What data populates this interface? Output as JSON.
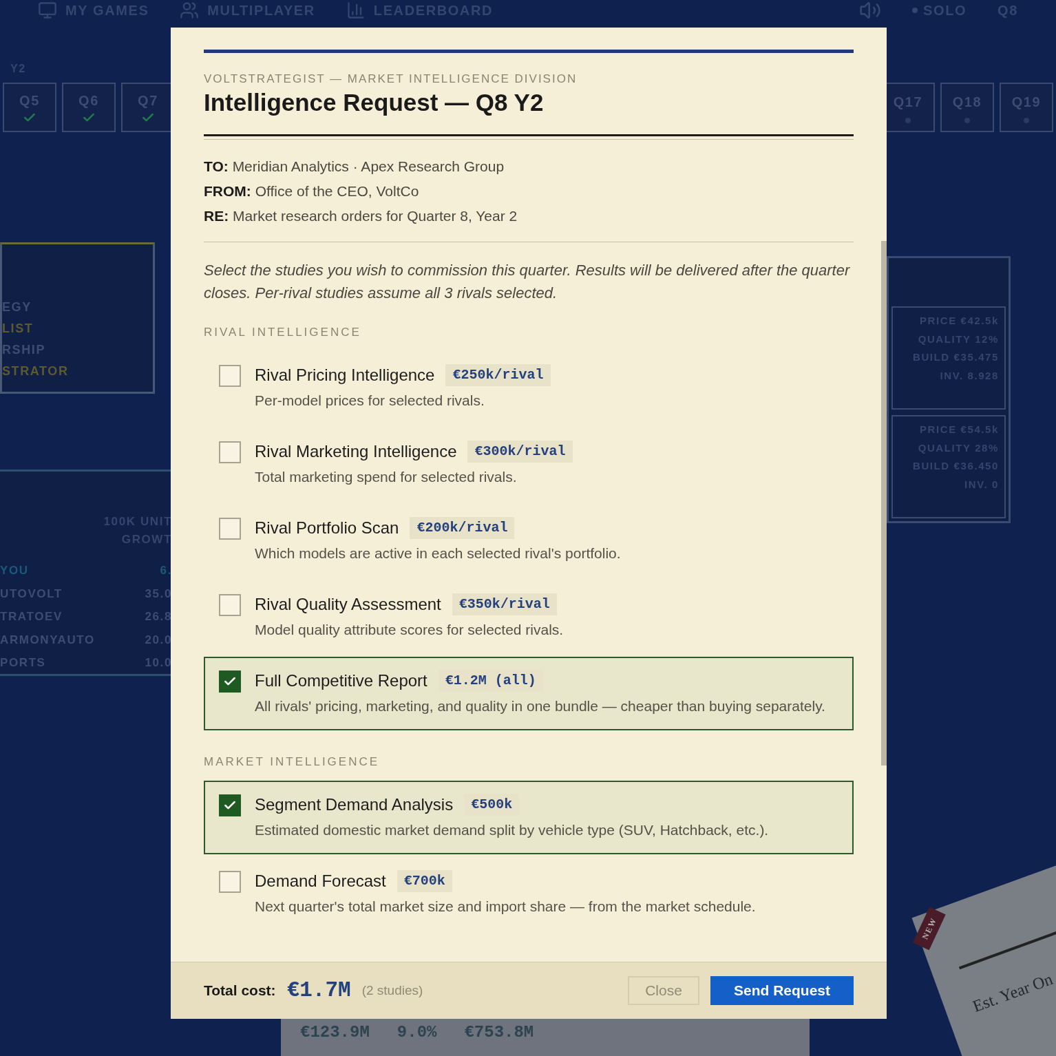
{
  "background": {
    "nav": [
      {
        "label": "MY GAMES",
        "kind": "monitor"
      },
      {
        "label": "MULTIPLAYER",
        "kind": "users"
      },
      {
        "label": "LEADERBOARD",
        "kind": "chart"
      }
    ],
    "mode": "SOLO",
    "quarter": "Q8",
    "season": "Y2",
    "quarters_left": [
      {
        "label": "Q5",
        "done": true
      },
      {
        "label": "Q6",
        "done": true
      },
      {
        "label": "Q7",
        "done": true
      }
    ],
    "quarters_right": [
      {
        "label": "Q17",
        "done": false
      },
      {
        "label": "Q18",
        "done": false
      },
      {
        "label": "Q19",
        "done": false
      }
    ],
    "profile_lines": [
      {
        "label": "EGY",
        "highlight": false
      },
      {
        "label": "LIST",
        "highlight": true
      },
      {
        "label": "RSHIP",
        "highlight": false
      },
      {
        "label": "STRATOR",
        "highlight": true
      }
    ],
    "table_header": [
      "100K UNIT",
      "GROWT"
    ],
    "table_rows": [
      {
        "name": "YOU",
        "value": "6.",
        "you": true
      },
      {
        "name": "UTOVOLT",
        "value": "35.0",
        "you": false
      },
      {
        "name": "TRATOEV",
        "value": "26.8",
        "you": false
      },
      {
        "name": "ARMONYAUTO",
        "value": "20.0",
        "you": false
      },
      {
        "name": "PORTS",
        "value": "10.0",
        "you": false
      }
    ],
    "model_cards": [
      {
        "fields": [
          {
            "label": "PRICE",
            "value": "€42.5k"
          },
          {
            "label": "QUALITY",
            "value": "12%"
          },
          {
            "label": "BUILD",
            "value": "€35.475"
          },
          {
            "label": "INV.",
            "value": "8.928"
          }
        ]
      },
      {
        "fields": [
          {
            "label": "PRICE",
            "value": "€54.5k"
          },
          {
            "label": "QUALITY",
            "value": "28%"
          },
          {
            "label": "BUILD",
            "value": "€36.450"
          },
          {
            "label": "INV.",
            "value": "0"
          }
        ]
      }
    ],
    "bottom_values": [
      "€123.9M",
      "9.0%",
      "€753.8M"
    ],
    "note": {
      "ribbon": "NEW",
      "text": "Est. Year On"
    }
  },
  "dialog": {
    "division": "VOLTSTRATEGIST — MARKET INTELLIGENCE DIVISION",
    "title": "Intelligence Request — Q8 Y2",
    "memo": [
      {
        "label": "TO:",
        "value": "Meridian Analytics · Apex Research Group"
      },
      {
        "label": "FROM:",
        "value": "Office of the CEO, VoltCo"
      },
      {
        "label": "RE:",
        "value": "Market research orders for Quarter 8, Year 2"
      }
    ],
    "intro": "Select the studies you wish to commission this quarter. Results will be delivered after the quarter closes. Per-rival studies assume all 3 rivals selected.",
    "sections": [
      {
        "title": "RIVAL INTELLIGENCE",
        "studies": [
          {
            "name": "Rival Pricing Intelligence",
            "price": "€250k/rival",
            "description": "Per-model prices for selected rivals.",
            "checked": false
          },
          {
            "name": "Rival Marketing Intelligence",
            "price": "€300k/rival",
            "description": "Total marketing spend for selected rivals.",
            "checked": false
          },
          {
            "name": "Rival Portfolio Scan",
            "price": "€200k/rival",
            "description": "Which models are active in each selected rival's portfolio.",
            "checked": false
          },
          {
            "name": "Rival Quality Assessment",
            "price": "€350k/rival",
            "description": "Model quality attribute scores for selected rivals.",
            "checked": false
          },
          {
            "name": "Full Competitive Report",
            "price": "€1.2M (all)",
            "description": "All rivals' pricing, marketing, and quality in one bundle — cheaper than buying separately.",
            "checked": true
          }
        ]
      },
      {
        "title": "MARKET INTELLIGENCE",
        "studies": [
          {
            "name": "Segment Demand Analysis",
            "price": "€500k",
            "description": "Estimated domestic market demand split by vehicle type (SUV, Hatchback, etc.).",
            "checked": true
          },
          {
            "name": "Demand Forecast",
            "price": "€700k",
            "description": "Next quarter's total market size and import share — from the market schedule.",
            "checked": false
          }
        ]
      }
    ],
    "footer": {
      "total_label": "Total cost:",
      "total": "€1.7M",
      "count": "(2 studies)",
      "close": "Close",
      "send": "Send Request",
      "close_disabled": true
    }
  }
}
